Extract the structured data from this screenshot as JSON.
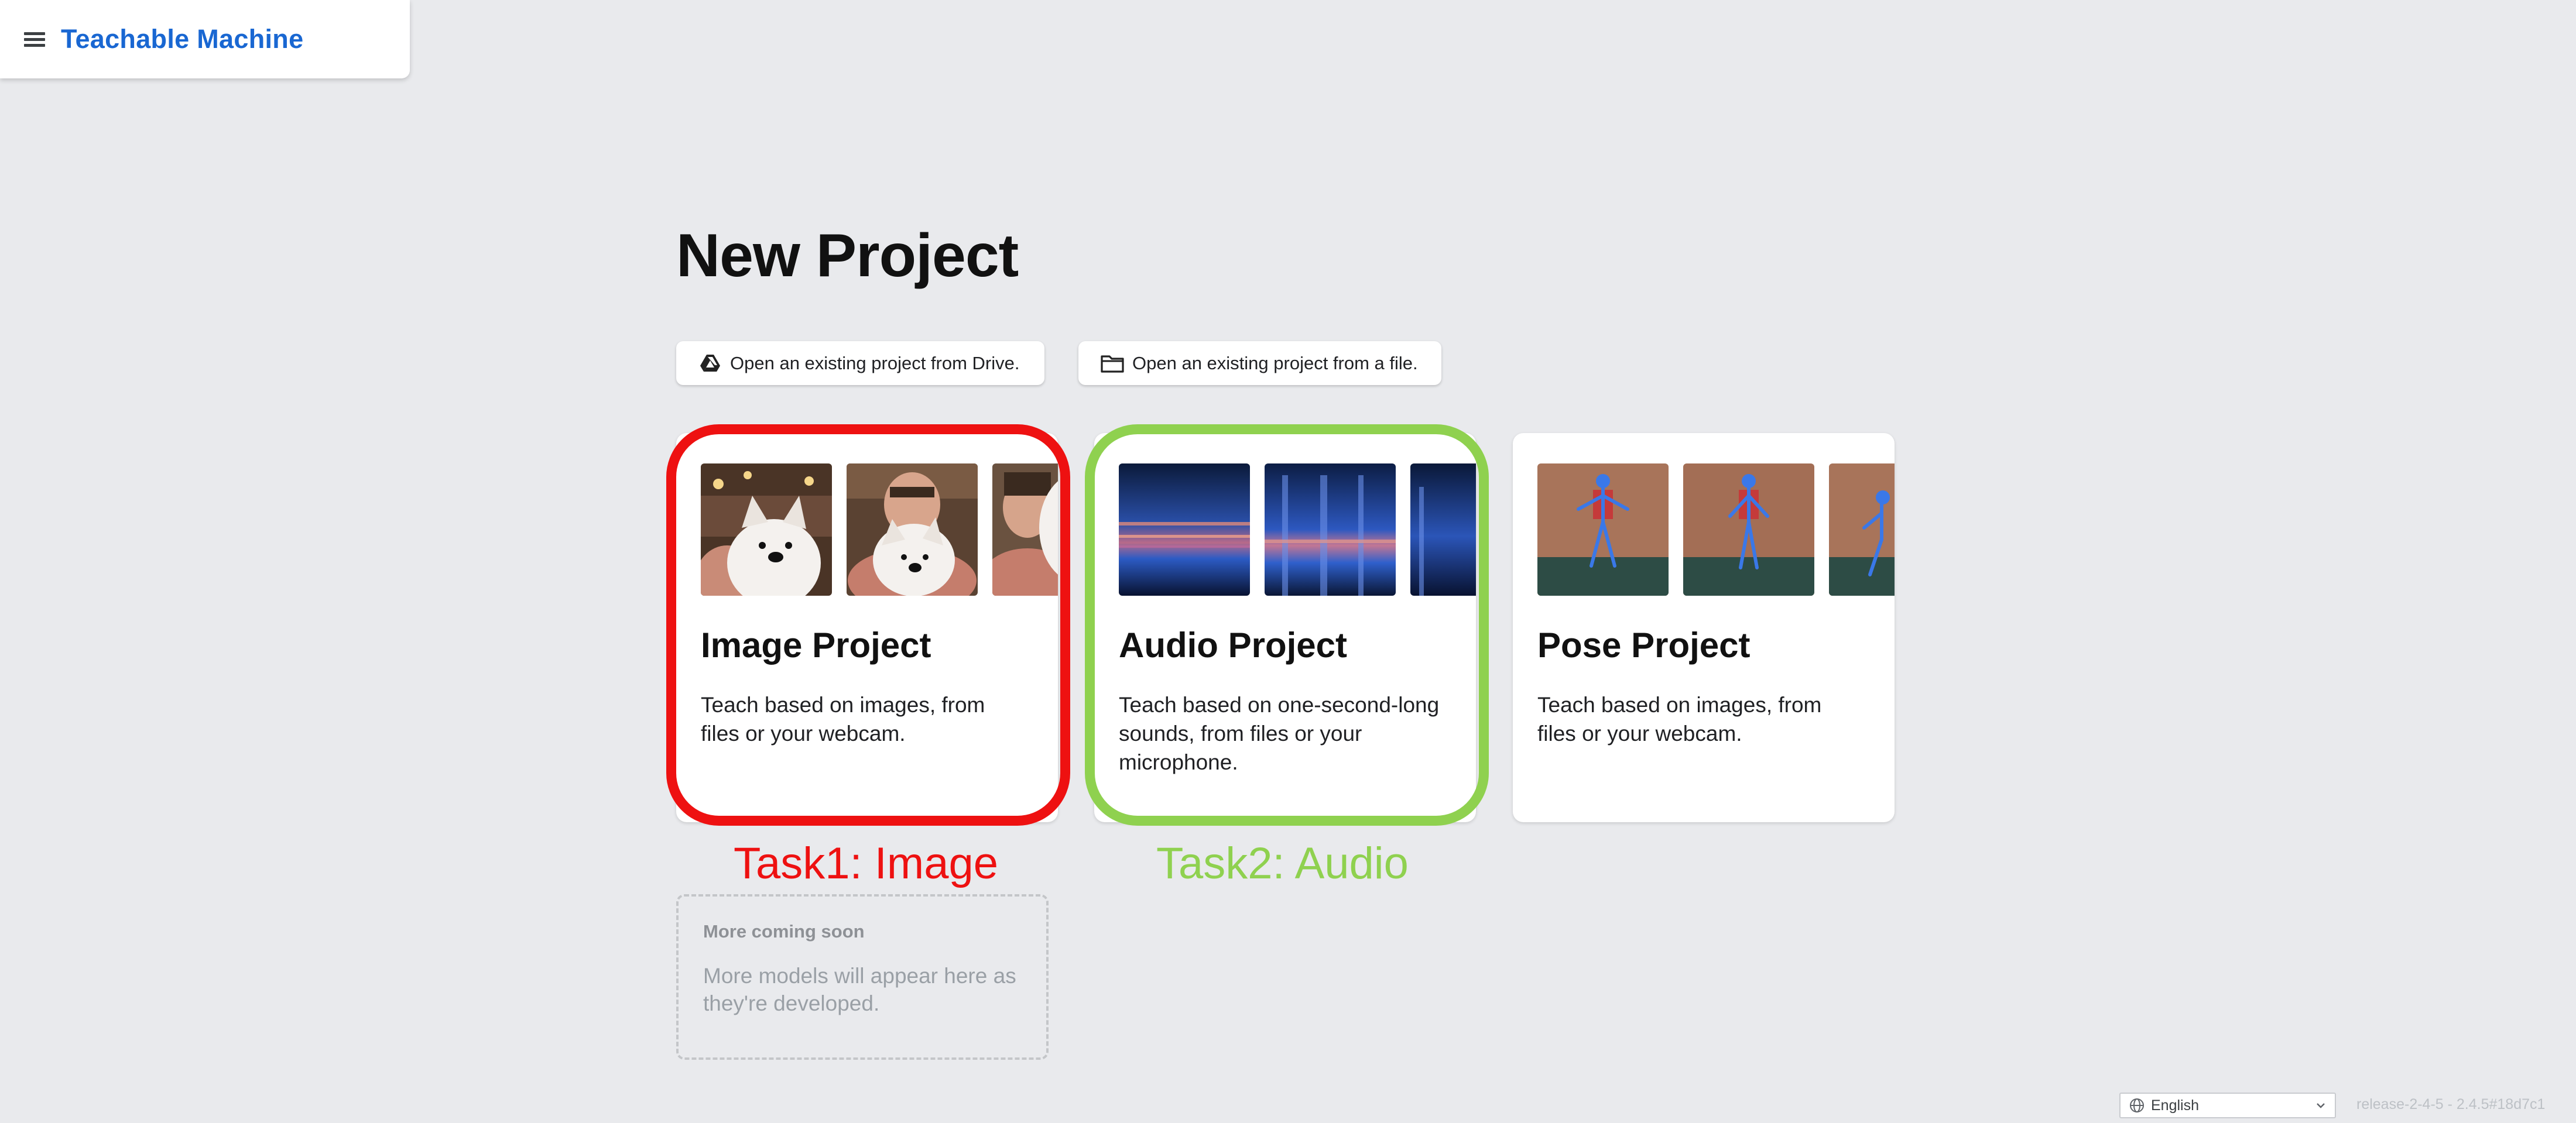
{
  "header": {
    "menu_icon": "hamburger-icon",
    "title": "Teachable Machine"
  },
  "page": {
    "title": "New Project"
  },
  "open_buttons": {
    "drive": {
      "icon": "google-drive-icon",
      "label": "Open an existing project from Drive."
    },
    "file": {
      "icon": "folder-icon",
      "label": "Open an existing project from a file."
    }
  },
  "cards": [
    {
      "title": "Image Project",
      "description": "Teach based on images, from files or your webcam."
    },
    {
      "title": "Audio Project",
      "description": "Teach based on one-second-long sounds, from files or your microphone."
    },
    {
      "title": "Pose Project",
      "description": "Teach based on images, from files or your webcam."
    }
  ],
  "annotations": {
    "task1": {
      "label": "Task1: Image",
      "color": "#ee1111"
    },
    "task2": {
      "label": "Task2: Audio",
      "color": "#8fd14f"
    }
  },
  "coming_soon": {
    "title": "More coming soon",
    "text": "More models will appear here as they're developed."
  },
  "footer": {
    "language_icon": "globe-icon",
    "language": "English",
    "release": "release-2-4-5 - 2.4.5#18d7c1"
  },
  "colors": {
    "brand": "#1967d2",
    "background": "#e9eaed",
    "card": "#ffffff"
  }
}
